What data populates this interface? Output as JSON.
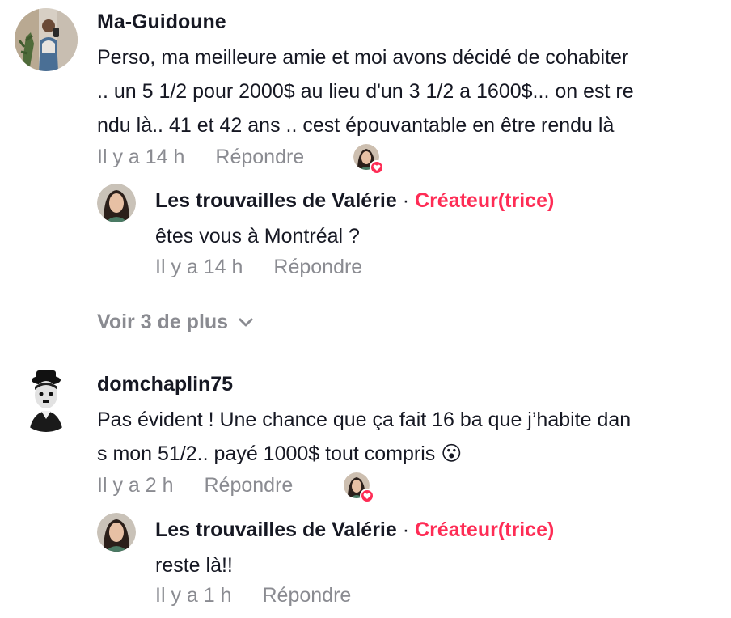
{
  "comments": [
    {
      "username": "Ma-Guidoune",
      "text_lines": [
        "Perso, ma meilleure amie et moi avons décidé de cohabiter",
        ".. un 5 1/2 pour 2000$ au lieu d'un 3 1/2 a 1600$... on est re",
        "ndu là.. 41 et 42 ans .. cest épouvantable en être rendu là"
      ],
      "time": "Il y a 14 h",
      "reply_label": "Répondre",
      "liked_by_creator": true,
      "replies": [
        {
          "username": "Les trouvailles de Valérie",
          "separator": "·",
          "tag": "Créateur(trice)",
          "text": "êtes vous à Montréal ?",
          "time": "Il y a 14 h",
          "reply_label": "Répondre"
        }
      ],
      "view_more": "Voir 3 de plus"
    },
    {
      "username": "domchaplin75",
      "text_lines": [
        "Pas évident ! Une chance que ça fait 16 ba que j’habite dan",
        "s mon 51/2.. payé 1000$ tout compris 😮"
      ],
      "time": "Il y a 2 h",
      "reply_label": "Répondre",
      "liked_by_creator": true,
      "replies": [
        {
          "username": "Les trouvailles de Valérie",
          "separator": "·",
          "tag": "Créateur(trice)",
          "text": "reste là!!",
          "time": "Il y a 1 h",
          "reply_label": "Répondre"
        }
      ]
    }
  ],
  "colors": {
    "creator_tag": "#fe2c55",
    "meta": "#8a8b91",
    "text": "#161823"
  },
  "icons": [
    "user-avatar",
    "creator-avatar",
    "heart-icon",
    "chevron-down-icon"
  ]
}
